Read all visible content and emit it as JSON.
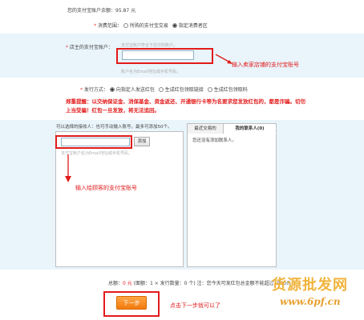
{
  "balance": {
    "label": "您的支付宝账户余额：",
    "value": "95.87 元"
  },
  "consume_range": {
    "label": "消费范围：",
    "options": [
      "所购的支付宝交易",
      "指定消费者区"
    ],
    "selected_index": 1
  },
  "shop_account": {
    "label": "店主的支付宝账户：",
    "placeholder": "支付宝账户符合下拉付的账户。",
    "value": "",
    "hint": "账户名为Email地址或手机号码。",
    "annotation": "输入卖家店铺的支付宝账号"
  },
  "issue_method": {
    "label": "发行方式：",
    "options": [
      "向指定人发送红包",
      "生成红包领取链接",
      "生成红包领取码"
    ],
    "selected_index": 0
  },
  "warning": "郑重提醒：以交纳保证金、消保基金、资金返还、开通银行卡等为名要求您发放红包的，都是诈骗。切勿上当受骗！红包一旦发放，将无法追回。",
  "recipients": {
    "instruction": "可以选择的接收人：也可手动输入账号，最多可添加50个。",
    "input_value": "",
    "add_button": "添加",
    "hint": "支付宝账户名为Email地址或手机号码。",
    "annotation": "输入给顾客的支付宝账号"
  },
  "contacts": {
    "tabs": [
      "最近交易的",
      "我的联系人(0)"
    ],
    "active_tab": 1,
    "empty_text": "您还没有添加联系人。"
  },
  "total": {
    "label": "总额：",
    "amount": "0 元",
    "detail": "(面额：1 × 发行数量：0 个)",
    "note": "注：您今天可发红包总金额不能超过1000元"
  },
  "next_button": "下一步",
  "next_annotation": "点击下一步就可以了",
  "watermark": {
    "title": "货源批发网",
    "url": "www.6pf.cn"
  },
  "colors": {
    "annotation_red": "#e21a1a",
    "button_orange": "#f27a0c",
    "panel_blue": "#e9f4fb"
  }
}
